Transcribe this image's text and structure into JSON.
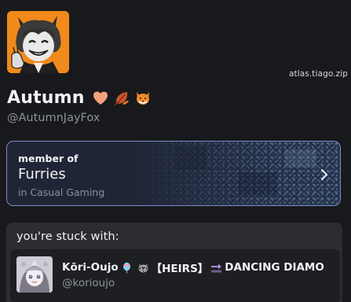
{
  "profile": {
    "display_name": "Autumn",
    "handle": "@AutumnJayFox",
    "domain": "atlas.tiago.zip",
    "avatar_icon": "fox-character-avatar",
    "name_emojis": [
      "orange-heart-icon",
      "fallen-leaf-icon",
      "fox-face-icon"
    ]
  },
  "membership": {
    "member_of_label": "member of",
    "group_name": "Furries",
    "context": "in Casual Gaming",
    "chevron_icon": "chevron-right-icon",
    "border_color": "#7b8ec9"
  },
  "stuck_with": {
    "title": "you're stuck with:",
    "user": {
      "name_part1": "Kōri-Oujo",
      "name_part2": "【HEIRS】",
      "name_part3": "DANCING DIAMO",
      "handle": "@korioujo",
      "name_icons": [
        "balloon-icon",
        "raccoon-icon",
        "soon-arrow-icon"
      ]
    }
  },
  "colors": {
    "background": "#18191c",
    "panel": "#2b2d31",
    "row": "#1e1f22",
    "muted_text": "#8e9297",
    "avatar_orange": "#f08a1c"
  }
}
